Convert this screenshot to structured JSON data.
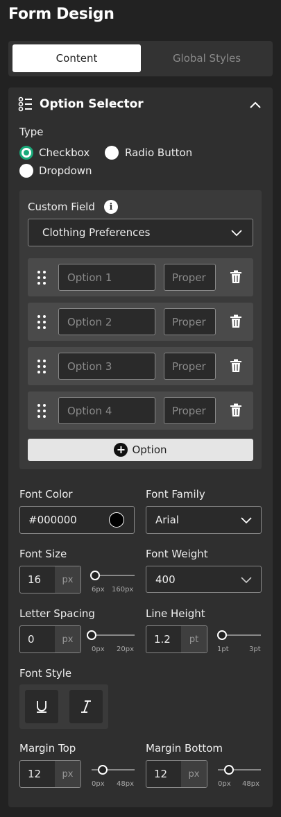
{
  "header": {
    "title": "Form Design"
  },
  "tabs": [
    {
      "label": "Content"
    },
    {
      "label": "Global Styles"
    }
  ],
  "section": {
    "title": "Option Selector",
    "type_label": "Type",
    "types": [
      {
        "label": "Checkbox",
        "checked": true
      },
      {
        "label": "Radio Button",
        "checked": false
      },
      {
        "label": "Dropdown",
        "checked": false
      }
    ]
  },
  "custom_field": {
    "label": "Custom Field",
    "selected": "Clothing Preferences",
    "options": [
      {
        "placeholder": "Option 1",
        "property_placeholder": "Proper"
      },
      {
        "placeholder": "Option 2",
        "property_placeholder": "Proper"
      },
      {
        "placeholder": "Option 3",
        "property_placeholder": "Proper"
      },
      {
        "placeholder": "Option 4",
        "property_placeholder": "Proper"
      }
    ],
    "add_label": "Option"
  },
  "styles": {
    "font_color": {
      "label": "Font Color",
      "value": "#000000",
      "swatch": "#000000"
    },
    "font_family": {
      "label": "Font Family",
      "value": "Arial"
    },
    "font_size": {
      "label": "Font Size",
      "value": "16",
      "unit": "px",
      "min": "6px",
      "max": "160px"
    },
    "font_weight": {
      "label": "Font Weight",
      "value": "400"
    },
    "letter_spacing": {
      "label": "Letter Spacing",
      "value": "0",
      "unit": "px",
      "min": "0px",
      "max": "20px"
    },
    "line_height": {
      "label": "Line Height",
      "value": "1.2",
      "unit": "pt",
      "min": "1pt",
      "max": "3pt"
    },
    "font_style": {
      "label": "Font Style"
    },
    "margin_top": {
      "label": "Margin Top",
      "value": "12",
      "unit": "px",
      "min": "0px",
      "max": "48px"
    },
    "margin_bottom": {
      "label": "Margin Bottom",
      "value": "12",
      "unit": "px",
      "min": "0px",
      "max": "48px"
    }
  },
  "colors": {
    "accent": "#1aaa7a",
    "panel": "#2f2f2f",
    "background": "#222222"
  }
}
